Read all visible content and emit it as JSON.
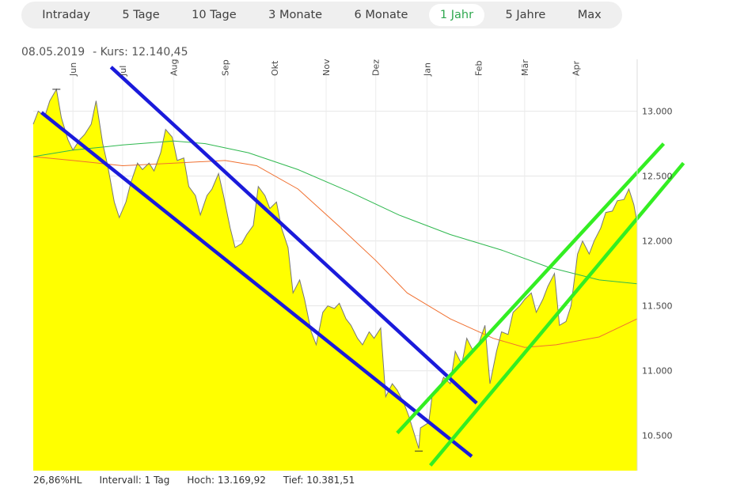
{
  "tabs": [
    {
      "label": "Intraday",
      "active": false
    },
    {
      "label": "5 Tage",
      "active": false
    },
    {
      "label": "10 Tage",
      "active": false
    },
    {
      "label": "3 Monate",
      "active": false
    },
    {
      "label": "6 Monate",
      "active": false
    },
    {
      "label": "1 Jahr",
      "active": true
    },
    {
      "label": "5 Jahre",
      "active": false
    },
    {
      "label": "Max",
      "active": false
    }
  ],
  "quote": {
    "date": "08.05.2019",
    "kurs": "- Kurs: 12.140,45"
  },
  "footer": {
    "hl": "26,86%HL",
    "interval": "Intervall: 1 Tag",
    "hoch": "Hoch:  13.169,92",
    "tief": "Tief:  10.381,51"
  },
  "colors": {
    "area": "#ffff00",
    "price_line": "#777777",
    "ma_orange": "#f07030",
    "ma_green": "#2fb84f",
    "channel_blue": "#1a1adb",
    "channel_green": "#33ee22",
    "active_tab": "#2fa84f"
  },
  "chart_data": {
    "type": "area",
    "y_tick_labels": [
      "13.000",
      "12.500",
      "12.000",
      "11.500",
      "11.000",
      "10.500"
    ],
    "y_ticks": [
      13000,
      12500,
      12000,
      11500,
      11000,
      10500
    ],
    "ylim": [
      10230,
      13400
    ],
    "xlim": [
      "2018-05-08",
      "2019-05-08"
    ],
    "month_labels": [
      {
        "label": "Jun",
        "date": "2018-06-01"
      },
      {
        "label": "Jul",
        "date": "2018-07-01"
      },
      {
        "label": "Aug",
        "date": "2018-08-01"
      },
      {
        "label": "Sep",
        "date": "2018-09-01"
      },
      {
        "label": "Okt",
        "date": "2018-10-01"
      },
      {
        "label": "Nov",
        "date": "2018-11-01"
      },
      {
        "label": "Dez",
        "date": "2018-12-01"
      },
      {
        "label": "Jan",
        "date": "2019-01-01"
      },
      {
        "label": "Feb",
        "date": "2019-02-01"
      },
      {
        "label": "Mär",
        "date": "2019-03-01"
      },
      {
        "label": "Apr",
        "date": "2019-04-01"
      }
    ],
    "grid": true,
    "price": [
      [
        "2018-05-08",
        12900
      ],
      [
        "2018-05-11",
        13000
      ],
      [
        "2018-05-15",
        12960
      ],
      [
        "2018-05-18",
        13080
      ],
      [
        "2018-05-22",
        13169
      ],
      [
        "2018-05-25",
        12950
      ],
      [
        "2018-05-29",
        12780
      ],
      [
        "2018-06-01",
        12700
      ],
      [
        "2018-06-05",
        12780
      ],
      [
        "2018-06-08",
        12820
      ],
      [
        "2018-06-12",
        12900
      ],
      [
        "2018-06-15",
        13080
      ],
      [
        "2018-06-19",
        12750
      ],
      [
        "2018-06-22",
        12580
      ],
      [
        "2018-06-26",
        12300
      ],
      [
        "2018-06-29",
        12180
      ],
      [
        "2018-07-03",
        12300
      ],
      [
        "2018-07-06",
        12450
      ],
      [
        "2018-07-10",
        12600
      ],
      [
        "2018-07-13",
        12550
      ],
      [
        "2018-07-17",
        12600
      ],
      [
        "2018-07-20",
        12540
      ],
      [
        "2018-07-24",
        12680
      ],
      [
        "2018-07-27",
        12860
      ],
      [
        "2018-07-31",
        12800
      ],
      [
        "2018-08-03",
        12620
      ],
      [
        "2018-08-07",
        12640
      ],
      [
        "2018-08-10",
        12420
      ],
      [
        "2018-08-14",
        12350
      ],
      [
        "2018-08-17",
        12200
      ],
      [
        "2018-08-21",
        12350
      ],
      [
        "2018-08-24",
        12400
      ],
      [
        "2018-08-28",
        12520
      ],
      [
        "2018-08-31",
        12350
      ],
      [
        "2018-09-04",
        12100
      ],
      [
        "2018-09-07",
        11950
      ],
      [
        "2018-09-11",
        11980
      ],
      [
        "2018-09-14",
        12050
      ],
      [
        "2018-09-18",
        12120
      ],
      [
        "2018-09-21",
        12420
      ],
      [
        "2018-09-25",
        12350
      ],
      [
        "2018-09-28",
        12250
      ],
      [
        "2018-10-02",
        12300
      ],
      [
        "2018-10-05",
        12100
      ],
      [
        "2018-10-09",
        11950
      ],
      [
        "2018-10-12",
        11600
      ],
      [
        "2018-10-16",
        11700
      ],
      [
        "2018-10-19",
        11550
      ],
      [
        "2018-10-23",
        11300
      ],
      [
        "2018-10-26",
        11200
      ],
      [
        "2018-10-30",
        11450
      ],
      [
        "2018-11-02",
        11500
      ],
      [
        "2018-11-06",
        11480
      ],
      [
        "2018-11-09",
        11520
      ],
      [
        "2018-11-13",
        11400
      ],
      [
        "2018-11-16",
        11350
      ],
      [
        "2018-11-20",
        11250
      ],
      [
        "2018-11-23",
        11200
      ],
      [
        "2018-11-27",
        11300
      ],
      [
        "2018-11-30",
        11250
      ],
      [
        "2018-12-04",
        11330
      ],
      [
        "2018-12-07",
        10800
      ],
      [
        "2018-12-11",
        10900
      ],
      [
        "2018-12-14",
        10850
      ],
      [
        "2018-12-18",
        10750
      ],
      [
        "2018-12-21",
        10650
      ],
      [
        "2018-12-27",
        10400
      ],
      [
        "2018-12-28",
        10560
      ],
      [
        "2019-01-02",
        10600
      ],
      [
        "2019-01-04",
        10800
      ],
      [
        "2019-01-08",
        10850
      ],
      [
        "2019-01-11",
        10950
      ],
      [
        "2019-01-15",
        10900
      ],
      [
        "2019-01-18",
        11150
      ],
      [
        "2019-01-22",
        11050
      ],
      [
        "2019-01-25",
        11250
      ],
      [
        "2019-01-29",
        11150
      ],
      [
        "2019-02-01",
        11200
      ],
      [
        "2019-02-05",
        11350
      ],
      [
        "2019-02-08",
        10900
      ],
      [
        "2019-02-12",
        11150
      ],
      [
        "2019-02-15",
        11300
      ],
      [
        "2019-02-19",
        11280
      ],
      [
        "2019-02-22",
        11450
      ],
      [
        "2019-02-26",
        11500
      ],
      [
        "2019-03-01",
        11550
      ],
      [
        "2019-03-05",
        11600
      ],
      [
        "2019-03-08",
        11450
      ],
      [
        "2019-03-12",
        11550
      ],
      [
        "2019-03-15",
        11650
      ],
      [
        "2019-03-19",
        11750
      ],
      [
        "2019-03-22",
        11350
      ],
      [
        "2019-03-26",
        11380
      ],
      [
        "2019-03-29",
        11500
      ],
      [
        "2019-04-02",
        11900
      ],
      [
        "2019-04-05",
        12000
      ],
      [
        "2019-04-09",
        11900
      ],
      [
        "2019-04-12",
        12000
      ],
      [
        "2019-04-16",
        12100
      ],
      [
        "2019-04-19",
        12220
      ],
      [
        "2019-04-23",
        12230
      ],
      [
        "2019-04-26",
        12310
      ],
      [
        "2019-04-30",
        12320
      ],
      [
        "2019-05-03",
        12400
      ],
      [
        "2019-05-06",
        12280
      ],
      [
        "2019-05-08",
        12140
      ]
    ],
    "moving_average_green": [
      [
        "2018-05-08",
        12650
      ],
      [
        "2018-06-01",
        12700
      ],
      [
        "2018-07-01",
        12740
      ],
      [
        "2018-08-01",
        12770
      ],
      [
        "2018-08-20",
        12750
      ],
      [
        "2018-09-15",
        12680
      ],
      [
        "2018-10-15",
        12550
      ],
      [
        "2018-11-15",
        12380
      ],
      [
        "2018-12-15",
        12200
      ],
      [
        "2019-01-15",
        12050
      ],
      [
        "2019-02-15",
        11930
      ],
      [
        "2019-03-15",
        11800
      ],
      [
        "2019-04-15",
        11700
      ],
      [
        "2019-05-08",
        11670
      ]
    ],
    "moving_average_orange": [
      [
        "2018-05-08",
        12650
      ],
      [
        "2018-06-01",
        12620
      ],
      [
        "2018-07-01",
        12580
      ],
      [
        "2018-08-01",
        12600
      ],
      [
        "2018-09-01",
        12620
      ],
      [
        "2018-09-20",
        12580
      ],
      [
        "2018-10-15",
        12400
      ],
      [
        "2018-11-10",
        12100
      ],
      [
        "2018-12-01",
        11850
      ],
      [
        "2018-12-20",
        11600
      ],
      [
        "2019-01-15",
        11400
      ],
      [
        "2019-02-10",
        11250
      ],
      [
        "2019-03-01",
        11180
      ],
      [
        "2019-03-20",
        11200
      ],
      [
        "2019-04-15",
        11260
      ],
      [
        "2019-05-08",
        11400
      ]
    ],
    "channel_lines": [
      {
        "color": "blue",
        "from": [
          "2018-05-13",
          12990
        ],
        "to": [
          "2019-01-28",
          10340
        ]
      },
      {
        "color": "blue",
        "from": [
          "2018-06-24",
          13340
        ],
        "to": [
          "2019-01-31",
          10750
        ]
      },
      {
        "color": "green",
        "from": [
          "2018-12-14",
          10520
        ],
        "to": [
          "2019-05-24",
          12750
        ]
      },
      {
        "color": "green",
        "from": [
          "2019-01-03",
          10270
        ],
        "to": [
          "2019-06-05",
          12600
        ]
      }
    ],
    "low_marker": [
      "2018-12-27",
      10381
    ],
    "high_marker": [
      "2018-05-22",
      13169
    ]
  }
}
